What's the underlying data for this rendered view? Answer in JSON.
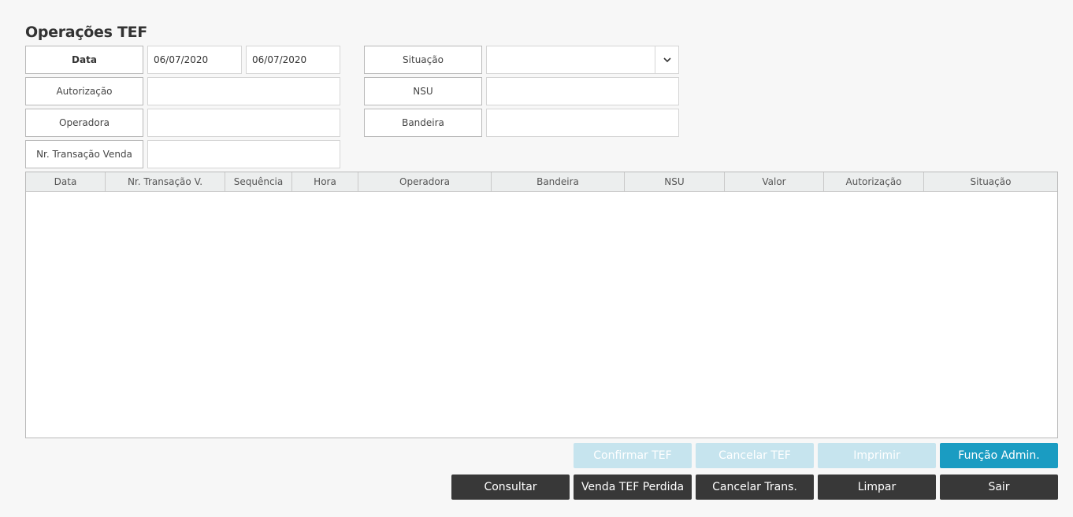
{
  "page": {
    "title": "Operações TEF"
  },
  "filters": {
    "data_label": "Data",
    "data_from": "06/07/2020",
    "data_to": "06/07/2020",
    "autorizacao_label": "Autorização",
    "autorizacao_value": "",
    "operadora_label": "Operadora",
    "operadora_value": "",
    "nr_transacao_label": "Nr. Transação Venda",
    "nr_transacao_value": "",
    "situacao_label": "Situação",
    "situacao_value": "",
    "nsu_label": "NSU",
    "nsu_value": "",
    "bandeira_label": "Bandeira",
    "bandeira_value": ""
  },
  "table": {
    "columns": [
      "Data",
      "Nr. Transação V.",
      "Sequência",
      "Hora",
      "Operadora",
      "Bandeira",
      "NSU",
      "Valor",
      "Autorização",
      "Situação"
    ],
    "rows": []
  },
  "actions": {
    "confirmar": "Confirmar TEF",
    "cancelar_tef": "Cancelar TEF",
    "imprimir": "Imprimir",
    "funcao_admin": "Função Admin.",
    "consultar": "Consultar",
    "venda_perdida": "Venda TEF Perdida",
    "cancelar_trans": "Cancelar Trans.",
    "limpar": "Limpar",
    "sair": "Sair"
  },
  "colors": {
    "primary": "#1a9cc2",
    "disabled": "#c6e4ee",
    "dark": "#383838"
  }
}
